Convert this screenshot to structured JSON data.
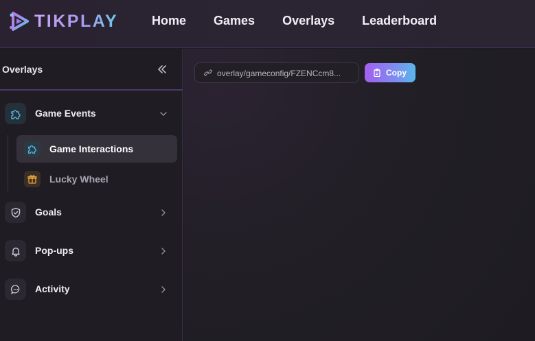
{
  "brand": {
    "name": "TIKPLAY"
  },
  "nav": {
    "items": [
      "Home",
      "Games",
      "Overlays",
      "Leaderboard"
    ]
  },
  "sidebar": {
    "title": "Overlays",
    "items": [
      {
        "label": "Game Events",
        "icon": "puzzle-icon",
        "expanded": true,
        "children": [
          {
            "label": "Game Interactions",
            "icon": "puzzle-icon",
            "selected": true
          },
          {
            "label": "Lucky Wheel",
            "icon": "gift-icon",
            "selected": false
          }
        ]
      },
      {
        "label": "Goals",
        "icon": "shield-check-icon"
      },
      {
        "label": "Pop-ups",
        "icon": "bell-icon"
      },
      {
        "label": "Activity",
        "icon": "chat-bubble-icon"
      }
    ]
  },
  "main": {
    "overlay_url": "overlay/gameconfig/FZENCcm8...",
    "copy_label": "Copy"
  },
  "colors": {
    "accent_gradient_start": "#a35ff0",
    "accent_gradient_end": "#59b7ea",
    "brand_purple": "#b89cf4",
    "icon_cyan": "#4fb6e6",
    "icon_orange": "#e8a33a"
  }
}
